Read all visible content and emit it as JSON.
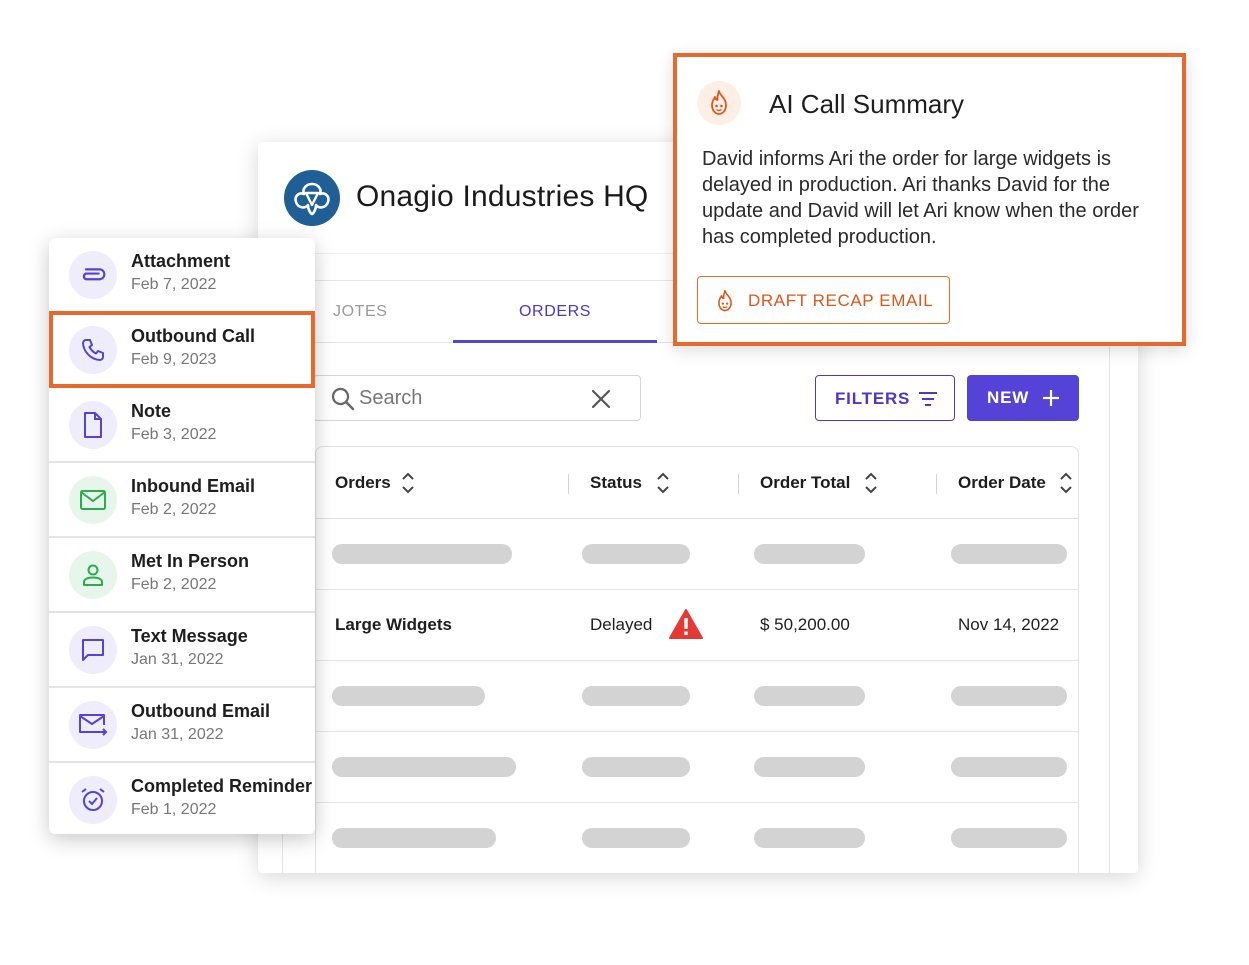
{
  "company": {
    "name": "Onagio Industries HQ"
  },
  "tabs": [
    {
      "label": "JOTES"
    },
    {
      "label": "ORDERS"
    }
  ],
  "toolbar": {
    "search_placeholder": "Search",
    "filters_label": "FILTERS",
    "new_label": "NEW"
  },
  "table": {
    "columns": [
      "Orders",
      "Status",
      "Order Total",
      "Order Date"
    ],
    "row": {
      "order": "Large Widgets",
      "status": "Delayed",
      "total": "$ 50,200.00",
      "date": "Nov 14, 2022"
    }
  },
  "activity": [
    {
      "title": "Attachment",
      "date": "Feb 7, 2022",
      "icon": "paperclip-icon"
    },
    {
      "title": "Outbound Call",
      "date": "Feb 9, 2023",
      "icon": "phone-icon"
    },
    {
      "title": "Note",
      "date": "Feb 3, 2022",
      "icon": "document-icon"
    },
    {
      "title": "Inbound Email",
      "date": "Feb 2, 2022",
      "icon": "mail-icon"
    },
    {
      "title": "Met In Person",
      "date": "Feb 2, 2022",
      "icon": "person-icon"
    },
    {
      "title": "Text Message",
      "date": "Jan 31, 2022",
      "icon": "chat-bubble-icon"
    },
    {
      "title": "Outbound Email",
      "date": "Jan 31, 2022",
      "icon": "mail-send-icon"
    },
    {
      "title": "Completed Reminder",
      "date": "Feb 1, 2022",
      "icon": "alarm-check-icon"
    }
  ],
  "ai_summary": {
    "title": "AI Call Summary",
    "text": "David informs Ari the order for large widgets is delayed in production. Ari thanks David for the update and David will let Ari know when the order has completed production.",
    "button_label": "DRAFT RECAP EMAIL"
  },
  "colors": {
    "brand_blue": "#1f5f95",
    "accent_purple": "#5542d6",
    "highlight_orange": "#e8692b",
    "warning_red": "#e53935",
    "activity_green": "#2eaa4f"
  }
}
